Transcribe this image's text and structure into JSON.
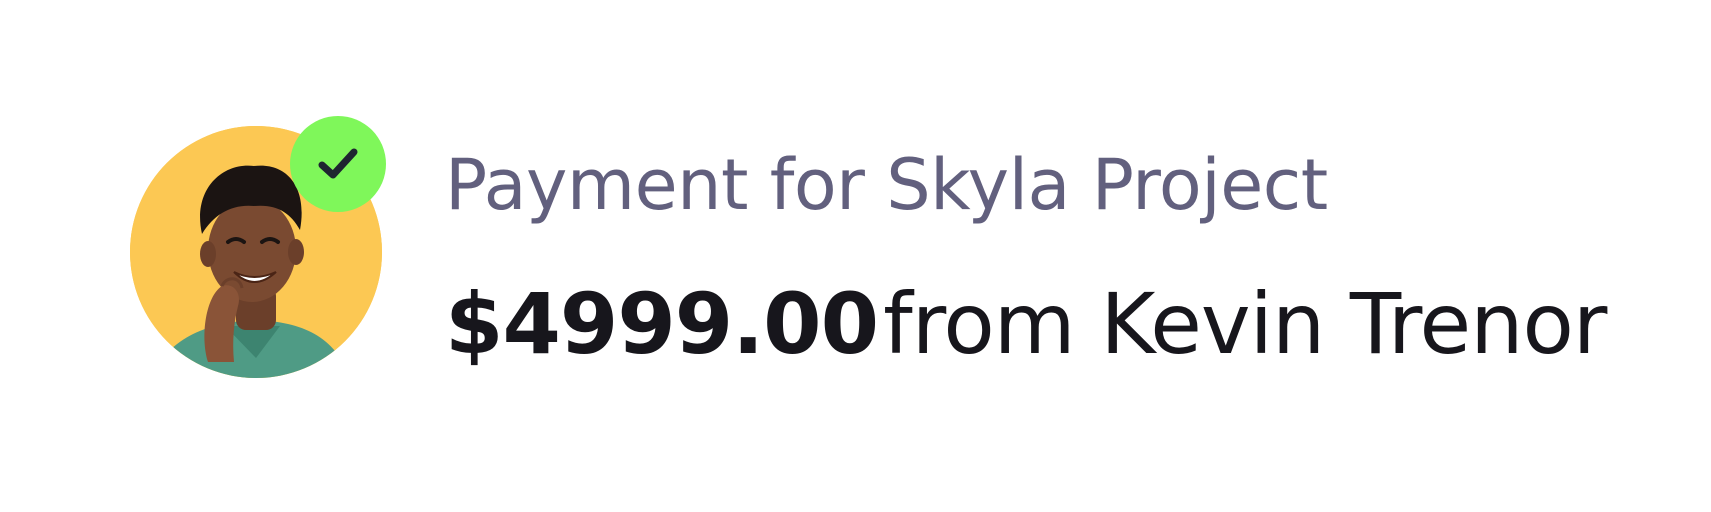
{
  "notification": {
    "title": "Payment for Skyla Project",
    "amount": "$4999.00",
    "from_text": "from Kevin Trenor",
    "avatar": {
      "icon": "user-photo",
      "background": "#fcc853"
    },
    "badge": {
      "icon": "checkmark-icon",
      "color": "#7ff75a"
    }
  }
}
